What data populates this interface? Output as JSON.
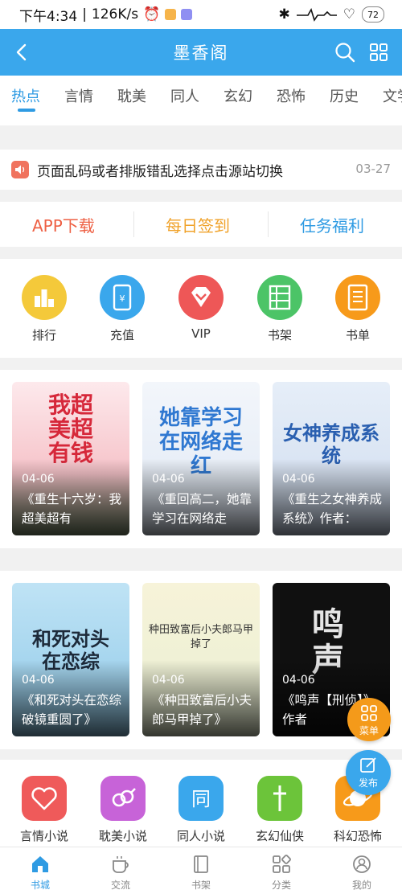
{
  "status": {
    "time": "下午4:34",
    "speed": "126K/s",
    "battery": "72"
  },
  "appbar": {
    "title": "墨香阁"
  },
  "tabs": [
    "热点",
    "言情",
    "耽美",
    "同人",
    "玄幻",
    "恐怖",
    "历史",
    "文学"
  ],
  "notice": {
    "text": "页面乱码或者排版错乱选择点击源站切换",
    "date": "03-27"
  },
  "actions": {
    "app_download": "APP下载",
    "daily_checkin": "每日签到",
    "task_rewards": "任务福利"
  },
  "icons": [
    {
      "label": "排行",
      "color": "#f4c93a",
      "icon": "ranking-icon"
    },
    {
      "label": "充值",
      "color": "#3aa7ec",
      "icon": "recharge-icon"
    },
    {
      "label": "VIP",
      "color": "#ee5757",
      "icon": "vip-diamond-icon"
    },
    {
      "label": "书架",
      "color": "#4cc467",
      "icon": "bookshelf-icon"
    },
    {
      "label": "书单",
      "color": "#f79a1a",
      "icon": "booklist-icon"
    }
  ],
  "books_row1": [
    {
      "date": "04-06",
      "title": "《重生十六岁：我超美超有",
      "cover_text": "我超美超有钱"
    },
    {
      "date": "04-06",
      "title": "《重回高二，她靠学习在网络走",
      "cover_text": "她靠学习在网络走红"
    },
    {
      "date": "04-06",
      "title": "《重生之女神养成系统》作者：",
      "cover_text": "女神养成系统"
    }
  ],
  "books_row2": [
    {
      "date": "04-06",
      "title": "《和死对头在恋综破镜重圆了》",
      "cover_text": "和死对头在恋综"
    },
    {
      "date": "04-06",
      "title": "《种田致富后小夫郎马甲掉了》",
      "cover_text": "种田致富后小夫郎马甲掉了"
    },
    {
      "date": "04-06",
      "title": "《鸣声【刑侦】》作者",
      "cover_text": "鸣声"
    }
  ],
  "fab": {
    "menu": "菜单",
    "post": "发布"
  },
  "categories": [
    {
      "label": "言情小说",
      "color": "#ef5a5a",
      "icon": "heart-icon"
    },
    {
      "label": "耽美小说",
      "color": "#c763d8",
      "icon": "gender-icon"
    },
    {
      "label": "同人小说",
      "color": "#3aa7ec",
      "icon": "tong-icon"
    },
    {
      "label": "玄幻仙侠",
      "color": "#6cc43a",
      "icon": "sword-icon"
    },
    {
      "label": "科幻恐怖",
      "color": "#f79a1a",
      "icon": "planet-icon"
    }
  ],
  "bottom_nav": [
    {
      "label": "书城",
      "icon": "home-icon",
      "active": true
    },
    {
      "label": "交流",
      "icon": "cup-icon",
      "active": false
    },
    {
      "label": "书架",
      "icon": "book-icon",
      "active": false
    },
    {
      "label": "分类",
      "icon": "category-icon",
      "active": false
    },
    {
      "label": "我的",
      "icon": "profile-icon",
      "active": false
    }
  ],
  "colors": {
    "accent": "#3aa7ec",
    "tab_active": "#2f9be3",
    "app_download": "#ee6044",
    "daily_checkin": "#f0a22a",
    "task_rewards": "#2f9be3"
  }
}
